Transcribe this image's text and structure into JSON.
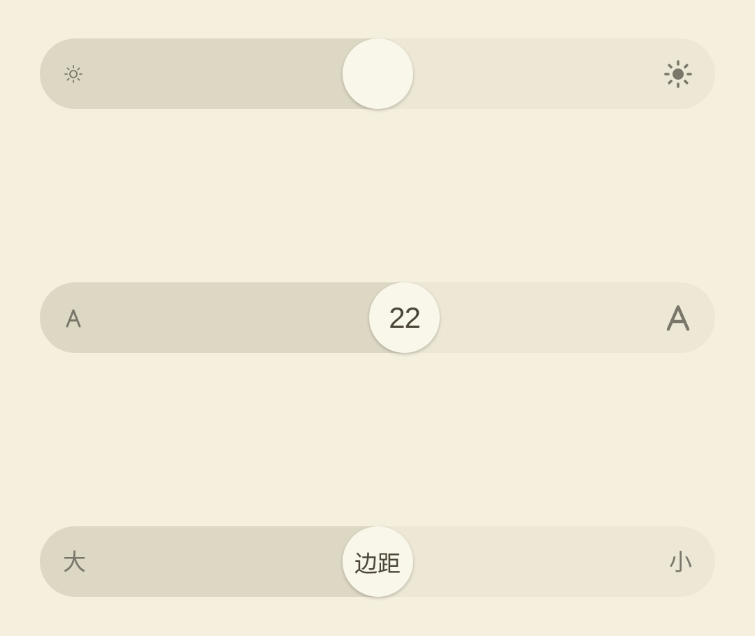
{
  "brightness": {
    "level_percent": 50,
    "min_icon": "sun-small-icon",
    "max_icon": "sun-large-icon"
  },
  "font_size": {
    "value": "22",
    "level_percent": 54,
    "min_icon": "letter-a-small-icon",
    "max_icon": "letter-a-large-icon"
  },
  "margin": {
    "label": "边距",
    "level_percent": 50,
    "left_label": "大",
    "right_label": "小"
  },
  "colors": {
    "background": "#f5f0de",
    "track": "#ede8d5",
    "fill": "#ddd8c4",
    "thumb": "#f9f6ea",
    "icon": "#7a7669",
    "thumb_text": "#4b4638"
  }
}
